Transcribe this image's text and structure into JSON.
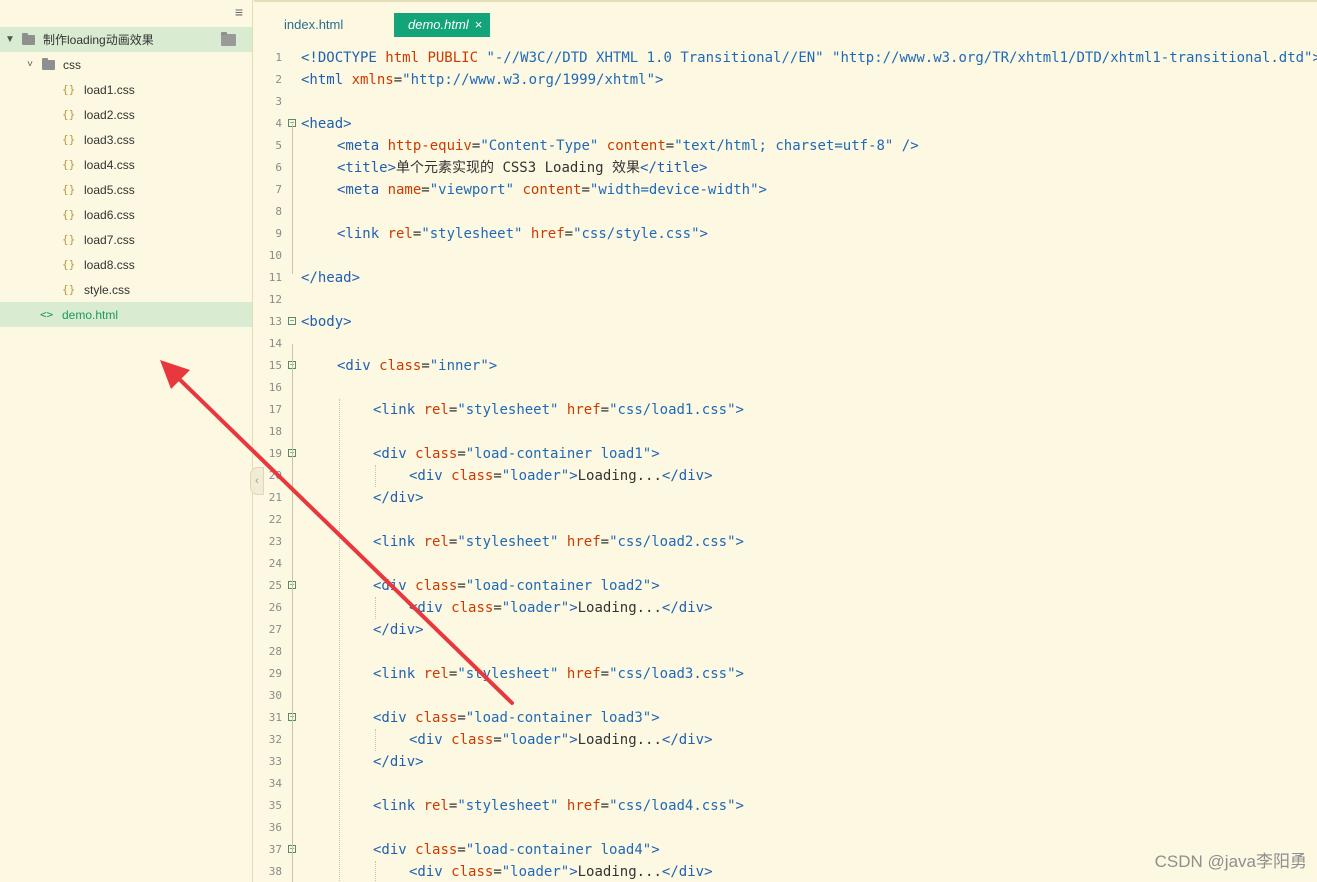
{
  "sidebar": {
    "project": "制作loading动画效果",
    "folder": "css",
    "files": [
      "load1.css",
      "load2.css",
      "load3.css",
      "load4.css",
      "load5.css",
      "load6.css",
      "load7.css",
      "load8.css",
      "style.css"
    ],
    "selected_file": "demo.html",
    "icons": {
      "menu": "menu-icon",
      "folder": "folder-icon",
      "css": "css-file-icon",
      "html": "html-file-icon",
      "collapse": "chevron-left-icon"
    }
  },
  "tabs": [
    {
      "label": "index.html",
      "active": false
    },
    {
      "label": "demo.html",
      "active": true,
      "close": "×"
    }
  ],
  "editor": {
    "lines": [
      {
        "n": "1",
        "indent": 0,
        "fold": false,
        "tokens": [
          [
            "t",
            "<!DOCTYPE "
          ],
          [
            "a",
            "html PUBLIC "
          ],
          [
            "s",
            "\"-//W3C//DTD XHTML 1.0 Transitional//EN\""
          ],
          [
            "x",
            " "
          ],
          [
            "s",
            "\"http://www.w3.org/TR/xhtml1/DTD/xhtml1-transitional.dtd\""
          ],
          [
            "t",
            ">"
          ]
        ]
      },
      {
        "n": "2",
        "indent": 0,
        "fold": false,
        "tokens": [
          [
            "t",
            "<html "
          ],
          [
            "a",
            "xmlns"
          ],
          [
            "x",
            "="
          ],
          [
            "s",
            "\"http://www.w3.org/1999/xhtml\""
          ],
          [
            "t",
            ">"
          ]
        ]
      },
      {
        "n": "3",
        "indent": 0,
        "fold": false,
        "tokens": []
      },
      {
        "n": "4",
        "indent": 0,
        "fold": true,
        "tokens": [
          [
            "t",
            "<head>"
          ]
        ]
      },
      {
        "n": "5",
        "indent": 1,
        "fold": false,
        "tokens": [
          [
            "t",
            "<meta "
          ],
          [
            "a",
            "http-equiv"
          ],
          [
            "x",
            "="
          ],
          [
            "s",
            "\"Content-Type\""
          ],
          [
            "x",
            " "
          ],
          [
            "a",
            "content"
          ],
          [
            "x",
            "="
          ],
          [
            "s",
            "\"text/html; charset=utf-8\""
          ],
          [
            "t",
            " />"
          ]
        ]
      },
      {
        "n": "6",
        "indent": 1,
        "fold": false,
        "tokens": [
          [
            "t",
            "<title>"
          ],
          [
            "x",
            "单个元素实现的 CSS3 Loading 效果"
          ],
          [
            "t",
            "</title>"
          ]
        ]
      },
      {
        "n": "7",
        "indent": 1,
        "fold": false,
        "tokens": [
          [
            "t",
            "<meta "
          ],
          [
            "a",
            "name"
          ],
          [
            "x",
            "="
          ],
          [
            "s",
            "\"viewport\""
          ],
          [
            "x",
            " "
          ],
          [
            "a",
            "content"
          ],
          [
            "x",
            "="
          ],
          [
            "s",
            "\"width=device-width\""
          ],
          [
            "t",
            ">"
          ]
        ]
      },
      {
        "n": "8",
        "indent": 0,
        "fold": false,
        "tokens": []
      },
      {
        "n": "9",
        "indent": 1,
        "fold": false,
        "tokens": [
          [
            "t",
            "<link "
          ],
          [
            "a",
            "rel"
          ],
          [
            "x",
            "="
          ],
          [
            "s",
            "\"stylesheet\""
          ],
          [
            "x",
            " "
          ],
          [
            "a",
            "href"
          ],
          [
            "x",
            "="
          ],
          [
            "s",
            "\"css/style.css\""
          ],
          [
            "t",
            ">"
          ]
        ]
      },
      {
        "n": "10",
        "indent": 0,
        "fold": false,
        "tokens": []
      },
      {
        "n": "11",
        "indent": 0,
        "fold": false,
        "tokens": [
          [
            "t",
            "</head>"
          ]
        ]
      },
      {
        "n": "12",
        "indent": 0,
        "fold": false,
        "tokens": []
      },
      {
        "n": "13",
        "indent": 0,
        "fold": true,
        "tokens": [
          [
            "t",
            "<body>"
          ]
        ]
      },
      {
        "n": "14",
        "indent": 0,
        "fold": false,
        "tokens": []
      },
      {
        "n": "15",
        "indent": 1,
        "fold": true,
        "tokens": [
          [
            "t",
            "<div "
          ],
          [
            "a",
            "class"
          ],
          [
            "x",
            "="
          ],
          [
            "s",
            "\"inner\""
          ],
          [
            "t",
            ">"
          ]
        ]
      },
      {
        "n": "16",
        "indent": 0,
        "fold": false,
        "tokens": []
      },
      {
        "n": "17",
        "indent": 2,
        "fold": false,
        "tokens": [
          [
            "t",
            "<link "
          ],
          [
            "a",
            "rel"
          ],
          [
            "x",
            "="
          ],
          [
            "s",
            "\"stylesheet\""
          ],
          [
            "x",
            " "
          ],
          [
            "a",
            "href"
          ],
          [
            "x",
            "="
          ],
          [
            "s",
            "\"css/load1.css\""
          ],
          [
            "t",
            ">"
          ]
        ]
      },
      {
        "n": "18",
        "indent": 0,
        "fold": false,
        "tokens": []
      },
      {
        "n": "19",
        "indent": 2,
        "fold": true,
        "tokens": [
          [
            "t",
            "<div "
          ],
          [
            "a",
            "class"
          ],
          [
            "x",
            "="
          ],
          [
            "s",
            "\"load-container load1\""
          ],
          [
            "t",
            ">"
          ]
        ]
      },
      {
        "n": "20",
        "indent": 3,
        "fold": false,
        "tokens": [
          [
            "t",
            "<div "
          ],
          [
            "a",
            "class"
          ],
          [
            "x",
            "="
          ],
          [
            "s",
            "\"loader\""
          ],
          [
            "t",
            ">"
          ],
          [
            "x",
            "Loading..."
          ],
          [
            "t",
            "</div>"
          ]
        ]
      },
      {
        "n": "21",
        "indent": 2,
        "fold": false,
        "tokens": [
          [
            "t",
            "</div>"
          ]
        ]
      },
      {
        "n": "22",
        "indent": 0,
        "fold": false,
        "tokens": []
      },
      {
        "n": "23",
        "indent": 2,
        "fold": false,
        "tokens": [
          [
            "t",
            "<link "
          ],
          [
            "a",
            "rel"
          ],
          [
            "x",
            "="
          ],
          [
            "s",
            "\"stylesheet\""
          ],
          [
            "x",
            " "
          ],
          [
            "a",
            "href"
          ],
          [
            "x",
            "="
          ],
          [
            "s",
            "\"css/load2.css\""
          ],
          [
            "t",
            ">"
          ]
        ]
      },
      {
        "n": "24",
        "indent": 0,
        "fold": false,
        "tokens": []
      },
      {
        "n": "25",
        "indent": 2,
        "fold": true,
        "tokens": [
          [
            "t",
            "<div "
          ],
          [
            "a",
            "class"
          ],
          [
            "x",
            "="
          ],
          [
            "s",
            "\"load-container load2\""
          ],
          [
            "t",
            ">"
          ]
        ]
      },
      {
        "n": "26",
        "indent": 3,
        "fold": false,
        "tokens": [
          [
            "t",
            "<div "
          ],
          [
            "a",
            "class"
          ],
          [
            "x",
            "="
          ],
          [
            "s",
            "\"loader\""
          ],
          [
            "t",
            ">"
          ],
          [
            "x",
            "Loading..."
          ],
          [
            "t",
            "</div>"
          ]
        ]
      },
      {
        "n": "27",
        "indent": 2,
        "fold": false,
        "tokens": [
          [
            "t",
            "</div>"
          ]
        ]
      },
      {
        "n": "28",
        "indent": 0,
        "fold": false,
        "tokens": []
      },
      {
        "n": "29",
        "indent": 2,
        "fold": false,
        "tokens": [
          [
            "t",
            "<link "
          ],
          [
            "a",
            "rel"
          ],
          [
            "x",
            "="
          ],
          [
            "s",
            "\"stylesheet\""
          ],
          [
            "x",
            " "
          ],
          [
            "a",
            "href"
          ],
          [
            "x",
            "="
          ],
          [
            "s",
            "\"css/load3.css\""
          ],
          [
            "t",
            ">"
          ]
        ]
      },
      {
        "n": "30",
        "indent": 0,
        "fold": false,
        "tokens": []
      },
      {
        "n": "31",
        "indent": 2,
        "fold": true,
        "tokens": [
          [
            "t",
            "<div "
          ],
          [
            "a",
            "class"
          ],
          [
            "x",
            "="
          ],
          [
            "s",
            "\"load-container load3\""
          ],
          [
            "t",
            ">"
          ]
        ]
      },
      {
        "n": "32",
        "indent": 3,
        "fold": false,
        "tokens": [
          [
            "t",
            "<div "
          ],
          [
            "a",
            "class"
          ],
          [
            "x",
            "="
          ],
          [
            "s",
            "\"loader\""
          ],
          [
            "t",
            ">"
          ],
          [
            "x",
            "Loading..."
          ],
          [
            "t",
            "</div>"
          ]
        ]
      },
      {
        "n": "33",
        "indent": 2,
        "fold": false,
        "tokens": [
          [
            "t",
            "</div>"
          ]
        ]
      },
      {
        "n": "34",
        "indent": 0,
        "fold": false,
        "tokens": []
      },
      {
        "n": "35",
        "indent": 2,
        "fold": false,
        "tokens": [
          [
            "t",
            "<link "
          ],
          [
            "a",
            "rel"
          ],
          [
            "x",
            "="
          ],
          [
            "s",
            "\"stylesheet\""
          ],
          [
            "x",
            " "
          ],
          [
            "a",
            "href"
          ],
          [
            "x",
            "="
          ],
          [
            "s",
            "\"css/load4.css\""
          ],
          [
            "t",
            ">"
          ]
        ]
      },
      {
        "n": "36",
        "indent": 0,
        "fold": false,
        "tokens": []
      },
      {
        "n": "37",
        "indent": 2,
        "fold": true,
        "tokens": [
          [
            "t",
            "<div "
          ],
          [
            "a",
            "class"
          ],
          [
            "x",
            "="
          ],
          [
            "s",
            "\"load-container load4\""
          ],
          [
            "t",
            ">"
          ]
        ]
      },
      {
        "n": "38",
        "indent": 3,
        "fold": false,
        "tokens": [
          [
            "t",
            "<div "
          ],
          [
            "a",
            "class"
          ],
          [
            "x",
            "="
          ],
          [
            "s",
            "\"loader\""
          ],
          [
            "t",
            ">"
          ],
          [
            "x",
            "Loading..."
          ],
          [
            "t",
            "</div>"
          ]
        ]
      }
    ]
  },
  "watermark": "CSDN @java李阳勇",
  "annotation_color": "#e8383d"
}
